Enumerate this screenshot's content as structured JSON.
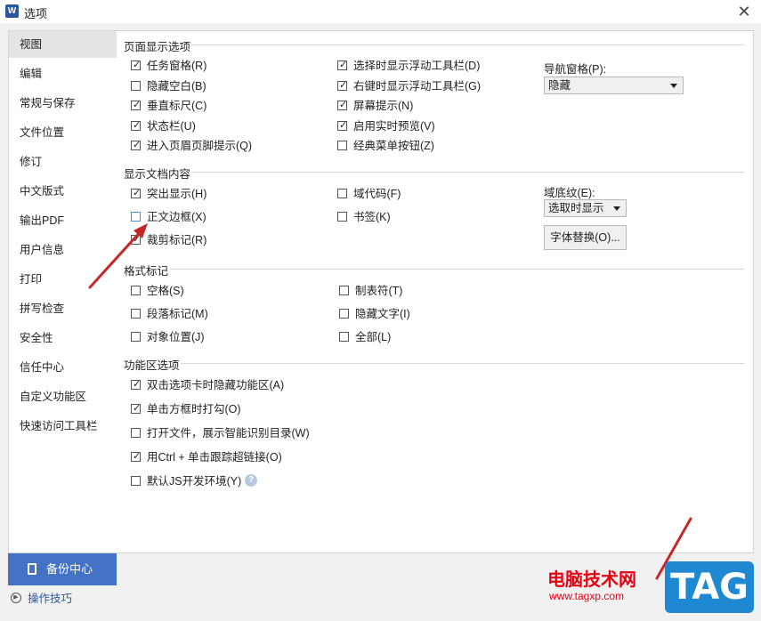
{
  "window": {
    "app_icon": "W",
    "title": "选项"
  },
  "sidebar": {
    "items": [
      {
        "label": "视图",
        "active": true
      },
      {
        "label": "编辑"
      },
      {
        "label": "常规与保存"
      },
      {
        "label": "文件位置"
      },
      {
        "label": "修订"
      },
      {
        "label": "中文版式"
      },
      {
        "label": "输出PDF"
      },
      {
        "label": "用户信息"
      },
      {
        "label": "打印"
      },
      {
        "label": "拼写检查"
      },
      {
        "label": "安全性"
      },
      {
        "label": "信任中心"
      },
      {
        "label": "自定义功能区"
      },
      {
        "label": "快速访问工具栏"
      }
    ],
    "backup_label": "备份中心",
    "tips_label": "操作技巧"
  },
  "sections": {
    "page_display": {
      "title": "页面显示选项",
      "options": [
        {
          "label": "任务窗格(R)",
          "checked": true
        },
        {
          "label": "隐藏空白(B)",
          "checked": false
        },
        {
          "label": "垂直标尺(C)",
          "checked": true
        },
        {
          "label": "状态栏(U)",
          "checked": true
        },
        {
          "label": "进入页眉页脚提示(Q)",
          "checked": true
        },
        {
          "label": "选择时显示浮动工具栏(D)",
          "checked": true
        },
        {
          "label": "右键时显示浮动工具栏(G)",
          "checked": true
        },
        {
          "label": "屏幕提示(N)",
          "checked": true
        },
        {
          "label": "启用实时预览(V)",
          "checked": true
        },
        {
          "label": "经典菜单按钮(Z)",
          "checked": false
        }
      ],
      "nav_label": "导航窗格(P):",
      "nav_value": "隐藏"
    },
    "doc_content": {
      "title": "显示文档内容",
      "options": [
        {
          "label": "突出显示(H)",
          "checked": true
        },
        {
          "label": "正文边框(X)",
          "checked": false
        },
        {
          "label": "裁剪标记(R)",
          "checked": true
        },
        {
          "label": "域代码(F)",
          "checked": false
        },
        {
          "label": "书签(K)",
          "checked": false
        }
      ],
      "shading_label": "域底纹(E):",
      "shading_value": "选取时显示",
      "font_sub_button": "字体替换(O)..."
    },
    "format_marks": {
      "title": "格式标记",
      "options": [
        {
          "label": "空格(S)",
          "checked": false
        },
        {
          "label": "段落标记(M)",
          "checked": false
        },
        {
          "label": "对象位置(J)",
          "checked": false
        },
        {
          "label": "制表符(T)",
          "checked": false
        },
        {
          "label": "隐藏文字(I)",
          "checked": false
        },
        {
          "label": "全部(L)",
          "checked": false
        }
      ]
    },
    "ribbon": {
      "title": "功能区选项",
      "options": [
        {
          "label": "双击选项卡时隐藏功能区(A)",
          "checked": true
        },
        {
          "label": "单击方框时打勾(O)",
          "checked": true
        },
        {
          "label": "打开文件，展示智能识别目录(W)",
          "checked": false
        },
        {
          "label": "用Ctrl + 单击跟踪超链接(O)",
          "checked": true
        },
        {
          "label": "默认JS开发环境(Y)",
          "checked": false
        }
      ]
    }
  },
  "watermark": {
    "text": "电脑技术网",
    "url": "www.tagxp.com",
    "tag": "TAG"
  },
  "colors": {
    "accent": "#4472c4",
    "arrow": "#c62828",
    "watermark_red": "#e60012",
    "tag_blue": "#1e88d3"
  }
}
